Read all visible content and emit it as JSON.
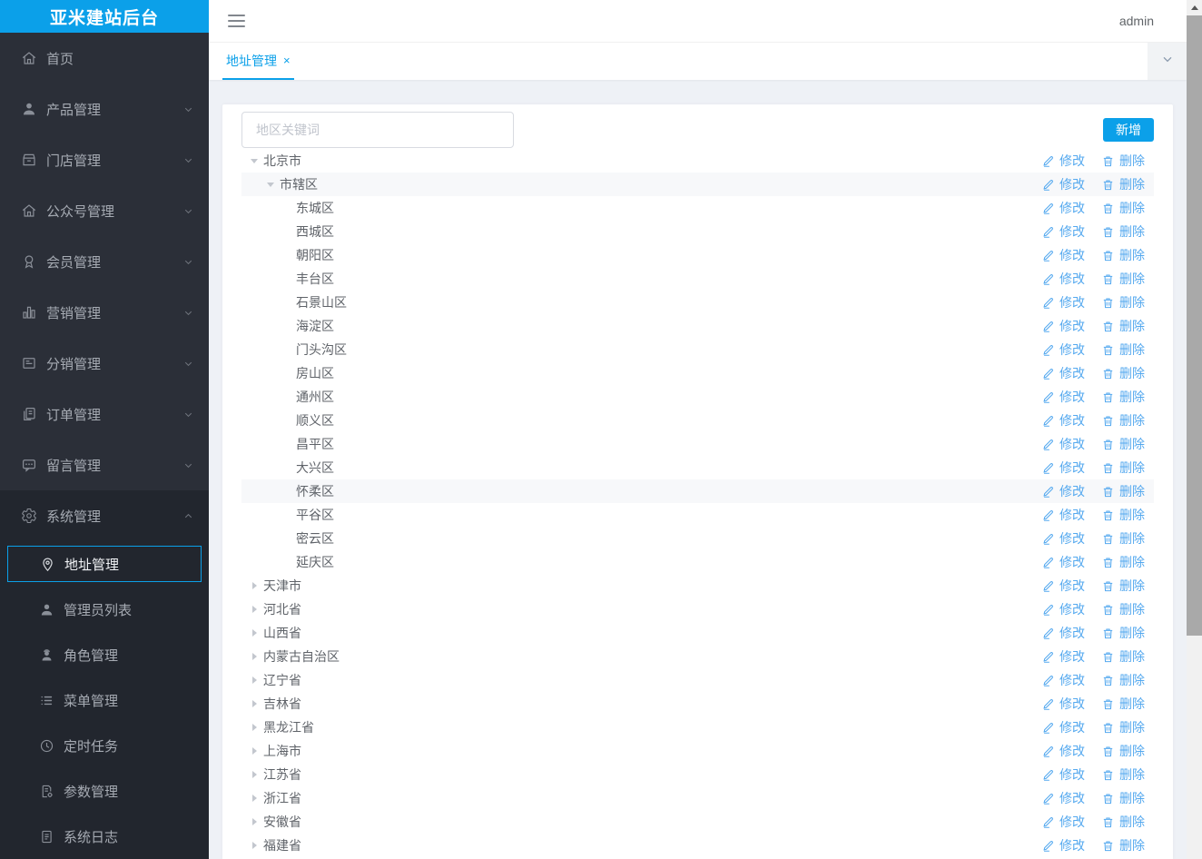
{
  "app": {
    "title": "亚米建站后台"
  },
  "colors": {
    "accent": "#0ba0e9",
    "action_link": "#55a9ef",
    "sidebar_bg": "#2b2f38",
    "sidebar_dark": "#22262e",
    "content_bg": "#eef1f6",
    "row_highlight": "#f7f8fa"
  },
  "topbar": {
    "username": "admin"
  },
  "tabs": {
    "items": [
      {
        "label": "地址管理",
        "close": "×",
        "active": true
      }
    ]
  },
  "toolbar": {
    "search_placeholder": "地区关键词",
    "add_button": "新增"
  },
  "sidebar": {
    "items": [
      {
        "key": "home",
        "icon": "home",
        "label": "首页",
        "chevron": null
      },
      {
        "key": "products",
        "icon": "user",
        "label": "产品管理",
        "chevron": "down"
      },
      {
        "key": "stores",
        "icon": "store",
        "label": "门店管理",
        "chevron": "down"
      },
      {
        "key": "wechat",
        "icon": "house",
        "label": "公众号管理",
        "chevron": "down"
      },
      {
        "key": "members",
        "icon": "award",
        "label": "会员管理",
        "chevron": "down"
      },
      {
        "key": "marketing",
        "icon": "chart",
        "label": "营销管理",
        "chevron": "down"
      },
      {
        "key": "distribution",
        "icon": "form",
        "label": "分销管理",
        "chevron": "down"
      },
      {
        "key": "orders",
        "icon": "copy",
        "label": "订单管理",
        "chevron": "down"
      },
      {
        "key": "messages",
        "icon": "chat",
        "label": "留言管理",
        "chevron": "down"
      }
    ],
    "system_group": {
      "key": "system",
      "icon": "gear",
      "label": "系统管理",
      "chevron": "up",
      "expanded": true,
      "children": [
        {
          "key": "address",
          "icon": "location",
          "label": "地址管理",
          "active": true
        },
        {
          "key": "admin-list",
          "icon": "user",
          "label": "管理员列表"
        },
        {
          "key": "roles",
          "icon": "worker",
          "label": "角色管理"
        },
        {
          "key": "menus",
          "icon": "list",
          "label": "菜单管理"
        },
        {
          "key": "cron",
          "icon": "clock",
          "label": "定时任务"
        },
        {
          "key": "params",
          "icon": "doc-gear",
          "label": "参数管理"
        },
        {
          "key": "logs",
          "icon": "doc",
          "label": "系统日志"
        }
      ]
    }
  },
  "tree": {
    "actions": {
      "edit": "修改",
      "delete": "删除"
    },
    "rows": [
      {
        "label": "北京市",
        "level": 0,
        "state": "expanded",
        "highlighted": false
      },
      {
        "label": "市辖区",
        "level": 1,
        "state": "expanded",
        "highlighted": true
      },
      {
        "label": "东城区",
        "level": 2,
        "state": "leaf",
        "highlighted": false
      },
      {
        "label": "西城区",
        "level": 2,
        "state": "leaf",
        "highlighted": false
      },
      {
        "label": "朝阳区",
        "level": 2,
        "state": "leaf",
        "highlighted": false
      },
      {
        "label": "丰台区",
        "level": 2,
        "state": "leaf",
        "highlighted": false
      },
      {
        "label": "石景山区",
        "level": 2,
        "state": "leaf",
        "highlighted": false
      },
      {
        "label": "海淀区",
        "level": 2,
        "state": "leaf",
        "highlighted": false
      },
      {
        "label": "门头沟区",
        "level": 2,
        "state": "leaf",
        "highlighted": false
      },
      {
        "label": "房山区",
        "level": 2,
        "state": "leaf",
        "highlighted": false
      },
      {
        "label": "通州区",
        "level": 2,
        "state": "leaf",
        "highlighted": false
      },
      {
        "label": "顺义区",
        "level": 2,
        "state": "leaf",
        "highlighted": false
      },
      {
        "label": "昌平区",
        "level": 2,
        "state": "leaf",
        "highlighted": false
      },
      {
        "label": "大兴区",
        "level": 2,
        "state": "leaf",
        "highlighted": false
      },
      {
        "label": "怀柔区",
        "level": 2,
        "state": "leaf",
        "highlighted": true
      },
      {
        "label": "平谷区",
        "level": 2,
        "state": "leaf",
        "highlighted": false
      },
      {
        "label": "密云区",
        "level": 2,
        "state": "leaf",
        "highlighted": false
      },
      {
        "label": "延庆区",
        "level": 2,
        "state": "leaf",
        "highlighted": false
      },
      {
        "label": "天津市",
        "level": 0,
        "state": "collapsed",
        "highlighted": false
      },
      {
        "label": "河北省",
        "level": 0,
        "state": "collapsed",
        "highlighted": false
      },
      {
        "label": "山西省",
        "level": 0,
        "state": "collapsed",
        "highlighted": false
      },
      {
        "label": "内蒙古自治区",
        "level": 0,
        "state": "collapsed",
        "highlighted": false
      },
      {
        "label": "辽宁省",
        "level": 0,
        "state": "collapsed",
        "highlighted": false
      },
      {
        "label": "吉林省",
        "level": 0,
        "state": "collapsed",
        "highlighted": false
      },
      {
        "label": "黑龙江省",
        "level": 0,
        "state": "collapsed",
        "highlighted": false
      },
      {
        "label": "上海市",
        "level": 0,
        "state": "collapsed",
        "highlighted": false
      },
      {
        "label": "江苏省",
        "level": 0,
        "state": "collapsed",
        "highlighted": false
      },
      {
        "label": "浙江省",
        "level": 0,
        "state": "collapsed",
        "highlighted": false
      },
      {
        "label": "安徽省",
        "level": 0,
        "state": "collapsed",
        "highlighted": false
      },
      {
        "label": "福建省",
        "level": 0,
        "state": "collapsed",
        "highlighted": false
      }
    ]
  }
}
